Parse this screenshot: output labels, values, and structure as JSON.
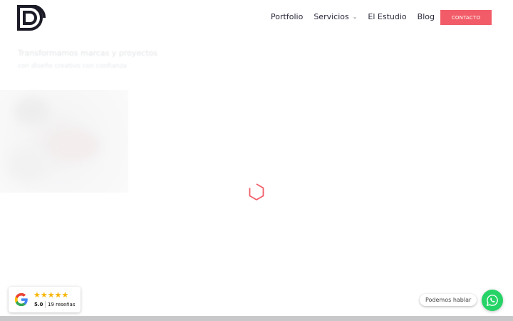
{
  "nav": {
    "items": [
      {
        "label": "Portfolio"
      },
      {
        "label": "Servicios",
        "has_dropdown": true
      },
      {
        "label": "El Estudio"
      },
      {
        "label": "Blog"
      }
    ],
    "cta_label": "CONTACTO"
  },
  "hero": {
    "title": "Transformamos marcas y proyectos",
    "subtitle": "con diseño creativo con confianza"
  },
  "reviews": {
    "stars": "★★★★★",
    "rating": "5.0",
    "count": "19 reseñas"
  },
  "chat": {
    "label": "Podemos hablar"
  },
  "colors": {
    "accent": "#f25c68",
    "whatsapp": "#25d366",
    "star": "#f7b500",
    "text": "#2a2a3c"
  }
}
